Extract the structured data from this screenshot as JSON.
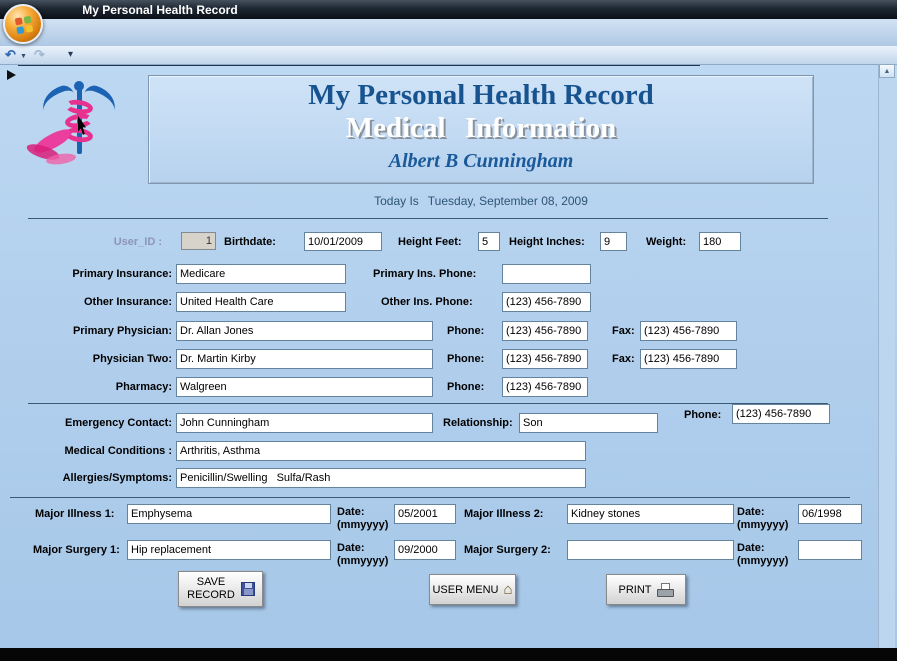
{
  "window": {
    "title": "My Personal Health Record"
  },
  "icons": {
    "undo": "↶",
    "redo": "↷",
    "dropdown": "▼",
    "qat_menu": "▾",
    "scroll_up": "▲",
    "home": "⌂"
  },
  "form": {
    "header": {
      "title": "My Personal Health Record",
      "subtitle": "Medical Information",
      "patient": "Albert B Cunningham"
    },
    "today": {
      "label": "Today Is",
      "value": "Tuesday, September 08, 2009"
    },
    "row1": {
      "user_id_label": "User_ID :",
      "user_id": "1",
      "birthdate_label": "Birthdate:",
      "birthdate": "10/01/2009",
      "height_feet_label": "Height Feet:",
      "height_feet": "5",
      "height_inches_label": "Height Inches:",
      "height_inches": "9",
      "weight_label": "Weight:",
      "weight": "180"
    },
    "insurance": {
      "primary_label": "Primary Insurance:",
      "primary": "Medicare",
      "primary_phone_label": "Primary Ins. Phone:",
      "primary_phone": "",
      "other_label": "Other Insurance:",
      "other": "United Health Care",
      "other_phone_label": "Other Ins. Phone:",
      "other_phone": "(123) 456-7890"
    },
    "physicians": {
      "primary_label": "Primary Physician:",
      "primary": "Dr. Allan Jones",
      "primary_phone_label": "Phone:",
      "primary_phone": "(123) 456-7890",
      "primary_fax_label": "Fax:",
      "primary_fax": "(123) 456-7890",
      "two_label": "Physician Two:",
      "two": "Dr. Martin Kirby",
      "two_phone_label": "Phone:",
      "two_phone": "(123) 456-7890",
      "two_fax_label": "Fax:",
      "two_fax": "(123) 456-7890",
      "pharmacy_label": "Pharmacy:",
      "pharmacy": "Walgreen",
      "pharmacy_phone_label": "Phone:",
      "pharmacy_phone": "(123) 456-7890"
    },
    "emergency": {
      "contact_label": "Emergency Contact:",
      "contact": "John Cunningham",
      "relationship_label": "Relationship:",
      "relationship": "Son",
      "phone_label": "Phone:",
      "phone": "(123) 456-7890",
      "conditions_label": "Medical Conditions :",
      "conditions": "Arthritis, Asthma",
      "allergies_label": "Allergies/Symptoms:",
      "allergies": "Penicillin/Swelling   Sulfa/Rash"
    },
    "history": {
      "date_label_line1": "Date:",
      "date_label_line2": "(mmyyyy)",
      "illness1_label": "Major Illness 1:",
      "illness1": "Emphysema",
      "illness1_date": "05/2001",
      "illness2_label": "Major Illness 2:",
      "illness2": "Kidney stones",
      "illness2_date": "06/1998",
      "surgery1_label": "Major Surgery 1:",
      "surgery1": "Hip replacement",
      "surgery1_date": "09/2000",
      "surgery2_label": "Major Surgery 2:",
      "surgery2": "",
      "surgery2_date": ""
    },
    "buttons": {
      "save": "SAVE RECORD",
      "user_menu": "USER MENU",
      "print": "PRINT"
    }
  }
}
